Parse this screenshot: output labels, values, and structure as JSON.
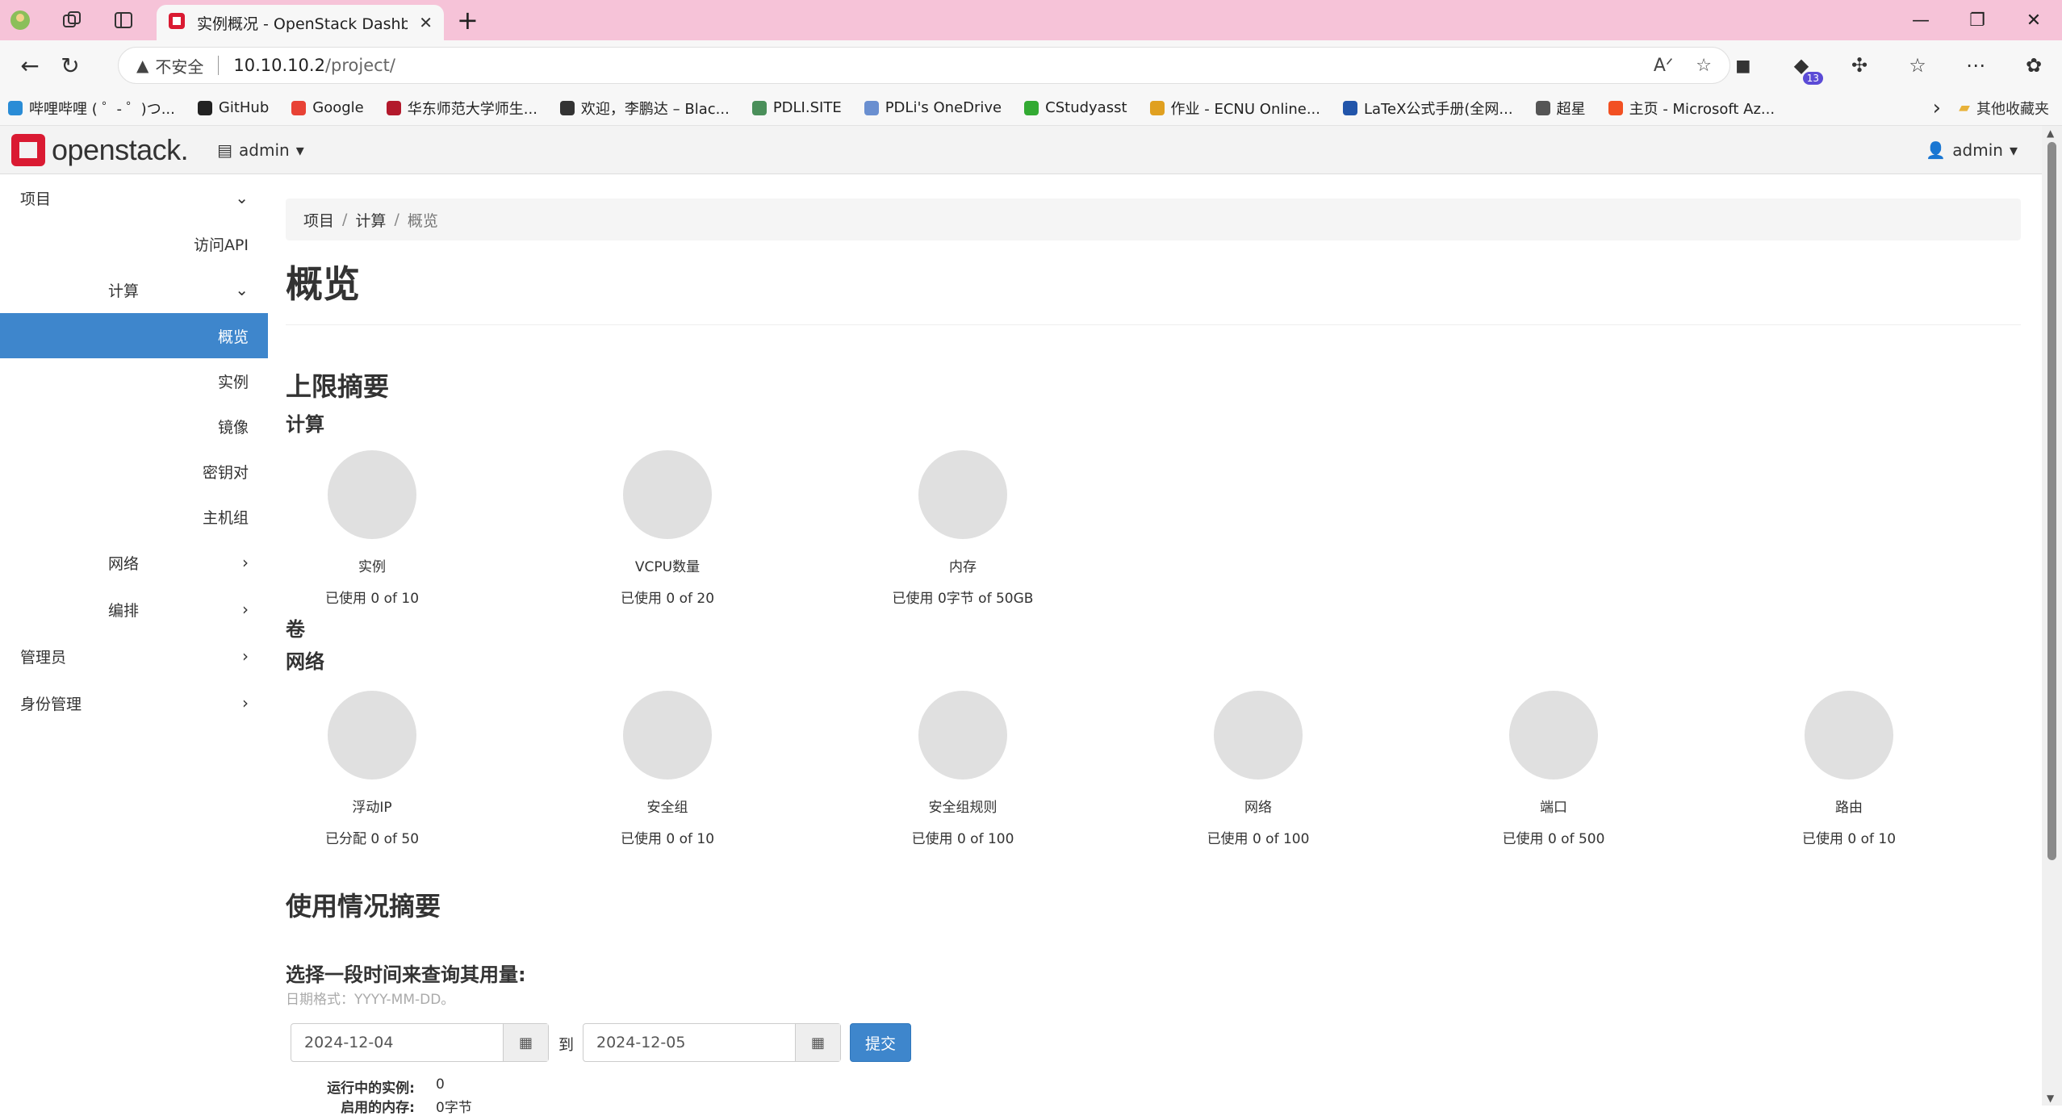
{
  "browser": {
    "tab_title": "实例概况 - OpenStack Dashboard",
    "insecure_label": "不安全",
    "url_host": "10.10.10.2",
    "url_path": "/project/",
    "extension_badge": "13"
  },
  "bookmarks": [
    {
      "label": "哔哩哔哩 ( ゜- ゜)つ...",
      "color": "#2a8cd6"
    },
    {
      "label": "GitHub",
      "color": "#222222"
    },
    {
      "label": "Google",
      "color": "#e84235"
    },
    {
      "label": "华东师范大学师生...",
      "color": "#b3192c"
    },
    {
      "label": "欢迎，李鹏达 – Blac...",
      "color": "#333333"
    },
    {
      "label": "PDLI.SITE",
      "color": "#4a8f5a"
    },
    {
      "label": "PDLi's OneDrive",
      "color": "#6a8fd0"
    },
    {
      "label": "CStudyasst",
      "color": "#33aa33"
    },
    {
      "label": "作业 - ECNU Online...",
      "color": "#e0a020"
    },
    {
      "label": "LaTeX公式手册(全网...",
      "color": "#2255aa"
    },
    {
      "label": "超星",
      "color": "#555555"
    },
    {
      "label": "主页 - Microsoft Az...",
      "color": "#f25022"
    }
  ],
  "bookmarks_other": "其他收藏夹",
  "topnav": {
    "logo": "openstack.",
    "project": "admin",
    "user": "admin"
  },
  "sidebar": {
    "project": "项目",
    "access_api": "访问API",
    "compute": "计算",
    "overview": "概览",
    "instances": "实例",
    "images": "镜像",
    "keypairs": "密钥对",
    "hostgroups": "主机组",
    "network": "网络",
    "orchestration": "编排",
    "admin": "管理员",
    "identity": "身份管理"
  },
  "breadcrumb": {
    "item1": "项目",
    "item2": "计算",
    "current": "概览"
  },
  "page_title": "概览",
  "limits": {
    "heading": "上限摘要",
    "compute_heading": "计算",
    "compute": [
      {
        "label": "实例",
        "usage": "已使用 0 of 10"
      },
      {
        "label": "VCPU数量",
        "usage": "已使用 0 of 20"
      },
      {
        "label": "内存",
        "usage": "已使用 0字节 of 50GB"
      }
    ],
    "volume_heading": "卷",
    "network_heading": "网络",
    "network": [
      {
        "label": "浮动IP",
        "usage": "已分配 0 of 50"
      },
      {
        "label": "安全组",
        "usage": "已使用 0 of 10"
      },
      {
        "label": "安全组规则",
        "usage": "已使用 0 of 100"
      },
      {
        "label": "网络",
        "usage": "已使用 0 of 100"
      },
      {
        "label": "端口",
        "usage": "已使用 0 of 500"
      },
      {
        "label": "路由",
        "usage": "已使用 0 of 10"
      }
    ]
  },
  "usage": {
    "heading": "使用情况摘要",
    "query_label": "选择一段时间来查询其用量:",
    "format_hint": "日期格式：YYYY-MM-DD。",
    "start_date": "2024-12-04",
    "to_label": "到",
    "end_date": "2024-12-05",
    "submit": "提交",
    "stats": [
      {
        "k": "运行中的实例:",
        "v": "0"
      },
      {
        "k": "启用的内存:",
        "v": "0字节"
      }
    ]
  }
}
